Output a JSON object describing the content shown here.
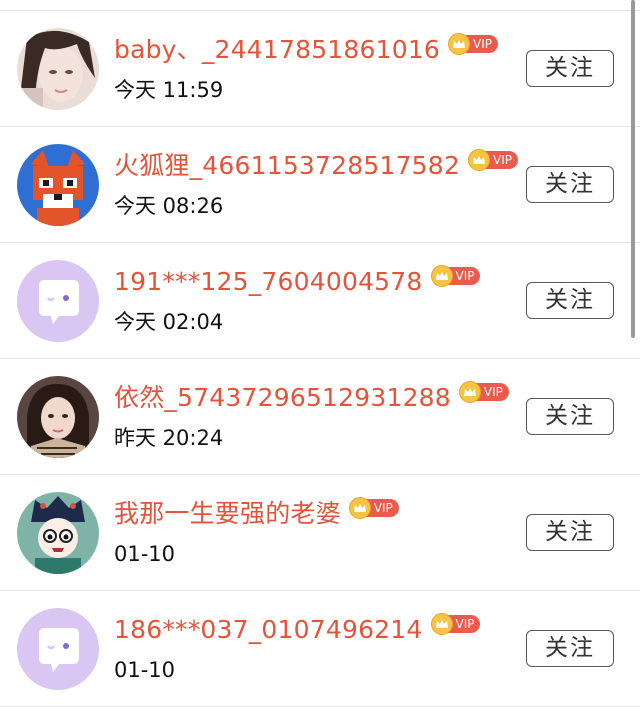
{
  "follow_label": "关注",
  "vip_label": "VIP",
  "users": [
    {
      "name": "baby、_24417851861016",
      "time": "今天 11:59",
      "avatar": "photo-girl-light"
    },
    {
      "name": "火狐狸_4661153728517582",
      "time": "今天 08:26",
      "avatar": "pixel-fox"
    },
    {
      "name": "191***125_7604004578",
      "time": "今天 02:04",
      "avatar": "default-chat"
    },
    {
      "name": "依然_5743729651293128​8",
      "time": "昨天 20:24",
      "avatar": "photo-girl-dark"
    },
    {
      "name": "我那一生要强的老婆",
      "time": "01-10",
      "avatar": "cartoon-queen"
    },
    {
      "name": "186***037_0107496214",
      "time": "01-10",
      "avatar": "default-chat"
    }
  ],
  "colors": {
    "name": "#e4543a",
    "vip_badge": "#ea5b4e",
    "crown": "#f6c445",
    "default_avatar": "#d9c6f3"
  }
}
